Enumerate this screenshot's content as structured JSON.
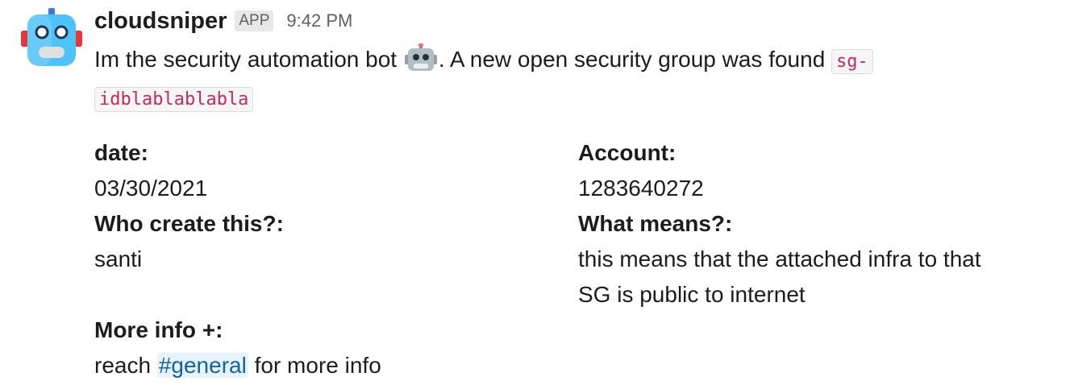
{
  "message": {
    "sender": "cloudsniper",
    "badge": "APP",
    "time": "9:42 PM",
    "text_before": "Im the security automation bot",
    "text_after": ". A new open security group was found",
    "sg_id_line1": "sg-",
    "sg_id_line2": "idblablablabla"
  },
  "fields": {
    "date_label": "date:",
    "date_value": "03/30/2021",
    "account_label": "Account:",
    "account_value": "1283640272",
    "creator_label": "Who create this?:",
    "creator_value": "santi",
    "means_label": "What means?:",
    "means_value_line1": "this means that the attached infra to that",
    "means_value_line2": "SG is public to internet",
    "more_label": "More info +:",
    "more_prefix": "reach",
    "more_channel": "#general",
    "more_suffix": "for more info"
  },
  "colors": {
    "mention": "#1264a3",
    "code": "#c52a5a",
    "avatar_body": "#4fc3f7",
    "avatar_ears": "#e53935"
  },
  "icons": {
    "avatar": "robot-avatar-icon",
    "emoji": "robot-face-icon"
  }
}
